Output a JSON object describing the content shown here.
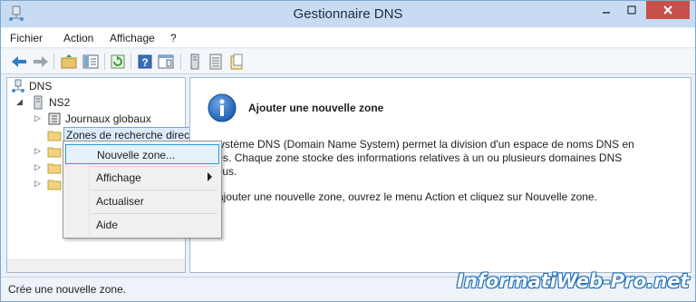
{
  "window": {
    "title": "Gestionnaire DNS"
  },
  "menubar": {
    "items": [
      "Fichier",
      "Action",
      "Affichage",
      "?"
    ]
  },
  "toolbar": {
    "icons": [
      "back-arrow-icon",
      "forward-arrow-icon",
      "up-folder-icon",
      "show-hide-tree-icon",
      "refresh-icon",
      "help-icon",
      "properties-icon",
      "server-icon",
      "list-icon",
      "notes-icon"
    ]
  },
  "tree": {
    "root": "DNS",
    "server": "NS2",
    "items": [
      "Journaux globaux",
      "Zones de recherche direc"
    ]
  },
  "content": {
    "heading": "Ajouter une nouvelle zone",
    "para1_line1": "e système DNS (Domain Name System) permet la division d'un espace de noms DNS en",
    "para1_line2": "ones. Chaque zone stocke des informations relatives à un ou plusieurs domaines DNS",
    "para1_line3": "ntigus.",
    "para2": "ur ajouter une nouvelle zone, ouvrez le menu Action et cliquez sur Nouvelle zone."
  },
  "context_menu": {
    "items": [
      "Nouvelle zone...",
      "Affichage",
      "Actualiser",
      "Aide"
    ]
  },
  "status": {
    "text": "Crée une nouvelle zone."
  },
  "watermark": "InformatiWeb-Pro.net",
  "colors": {
    "accent": "#26a0da",
    "close": "#c7504a",
    "info_blue": "#1c5fb0"
  }
}
